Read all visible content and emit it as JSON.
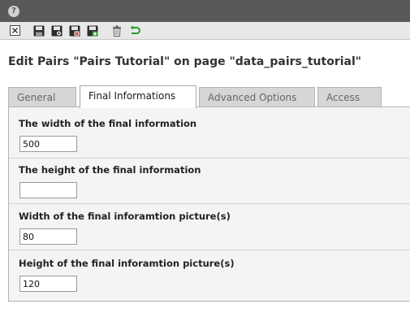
{
  "toolbar": {
    "buttons": [
      {
        "icon": "close-icon",
        "title": "Close"
      },
      {
        "icon": "save-icon",
        "title": "Save"
      },
      {
        "icon": "save-view-icon",
        "title": "Save and view"
      },
      {
        "icon": "save-close-icon",
        "title": "Save and close"
      },
      {
        "icon": "save-new-icon",
        "title": "Save and create new"
      },
      {
        "icon": "trash-icon",
        "title": "Delete"
      },
      {
        "icon": "undo-icon",
        "title": "Undo"
      }
    ]
  },
  "page": {
    "title": "Edit Pairs \"Pairs Tutorial\" on page \"data_pairs_tutorial\""
  },
  "tabs": [
    {
      "label": "General",
      "active": false
    },
    {
      "label": "Final Informations",
      "active": true
    },
    {
      "label": "Advanced Options",
      "active": false
    },
    {
      "label": "Access",
      "active": false
    }
  ],
  "fields": [
    {
      "label": "The width of the final information",
      "value": "500"
    },
    {
      "label": "The height of the final information",
      "value": ""
    },
    {
      "label": "Width of the final inforamtion picture(s)",
      "value": "80"
    },
    {
      "label": "Height of the final inforamtion picture(s)",
      "value": "120"
    }
  ],
  "colors": {
    "topbar": "#595959",
    "toolbar": "#e8e8e8",
    "panel": "#f4f4f4",
    "undo_green": "#2e9b2e"
  }
}
